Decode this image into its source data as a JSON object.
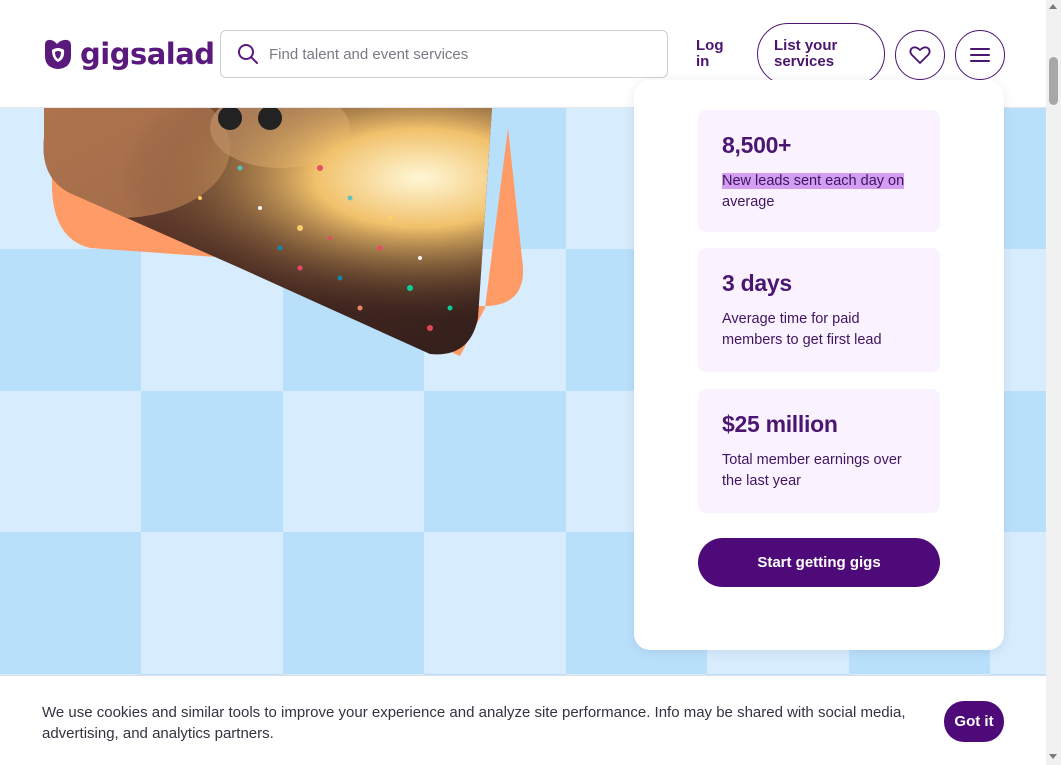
{
  "header": {
    "logo_text": "gigsalad",
    "search_placeholder": "Find talent and event services",
    "login_label": "Log in",
    "list_services_label": "List your services",
    "icons": {
      "search": "search-icon",
      "heart": "heart-icon",
      "menu": "hamburger-menu-icon"
    }
  },
  "stats": [
    {
      "value": "8,500+",
      "description_highlight": "New leads sent each day on",
      "description_rest": "average"
    },
    {
      "value": "3 days",
      "description": "Average time for paid members to get first lead"
    },
    {
      "value": "$25 million",
      "description": "Total member earnings over the last year"
    }
  ],
  "cta_label": "Start getting gigs",
  "cookie": {
    "text": "We use cookies and similar tools to improve your experience and analyze site performance. Info may be shared with social media, advertising, and analytics partners.",
    "button_label": "Got it"
  },
  "colors": {
    "brand_purple": "#4e0a78",
    "accent_orange": "#ff9b66",
    "stat_bg": "#fbf2ff",
    "pattern_dark": "#b9e0fb",
    "pattern_light": "#d7ecfd"
  }
}
